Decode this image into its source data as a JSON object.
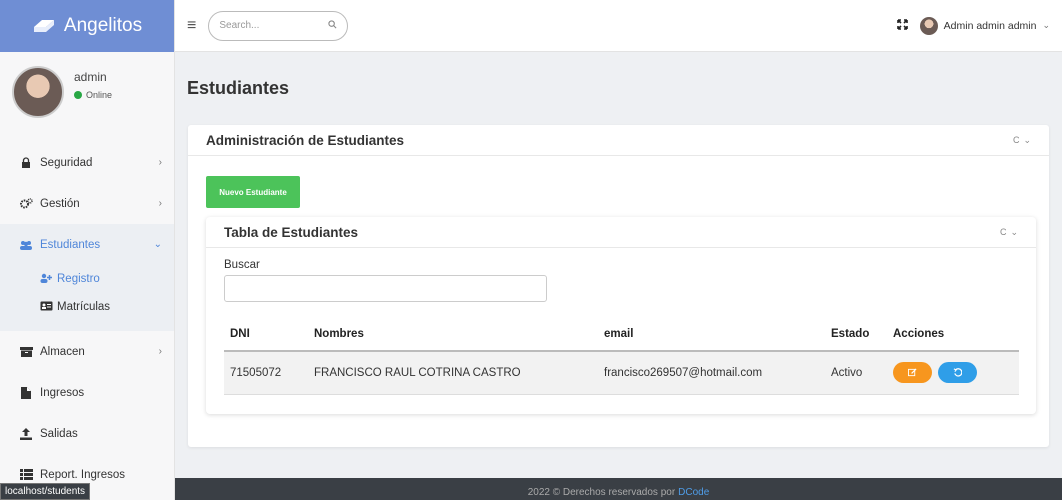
{
  "brand": {
    "name": "Angelitos"
  },
  "user_panel": {
    "name": "admin",
    "status": "Online"
  },
  "sidebar": {
    "items": [
      {
        "label": "Seguridad",
        "icon": "lock-icon",
        "arrow": "›"
      },
      {
        "label": "Gestión",
        "icon": "cogs-icon",
        "arrow": "›"
      },
      {
        "label": "Estudiantes",
        "icon": "users-icon",
        "arrow": "⌄"
      },
      {
        "label": "Almacen",
        "icon": "archive-icon",
        "arrow": "›"
      },
      {
        "label": "Ingresos",
        "icon": "file-icon",
        "arrow": ""
      },
      {
        "label": "Salidas",
        "icon": "upload-icon",
        "arrow": ""
      },
      {
        "label": "Report. Ingresos",
        "icon": "list-icon",
        "arrow": ""
      }
    ],
    "subitems": [
      {
        "label": "Registro",
        "icon": "user-plus-icon"
      },
      {
        "label": "Matrículas",
        "icon": "id-card-icon"
      }
    ]
  },
  "topbar": {
    "search_placeholder": "Search...",
    "user_label": "Admin admin admin"
  },
  "page": {
    "title": "Estudiantes"
  },
  "card": {
    "title": "Administración de Estudiantes",
    "new_button": "Nuevo Estudiante"
  },
  "table_card": {
    "title": "Tabla de Estudiantes",
    "search_label": "Buscar",
    "columns": [
      "DNI",
      "Nombres",
      "email",
      "Estado",
      "Acciones"
    ],
    "rows": [
      {
        "dni": "71505072",
        "nombres": "FRANCISCO RAUL COTRINA CASTRO",
        "email": "francisco269507@hotmail.com",
        "estado": "Activo"
      }
    ]
  },
  "footer": {
    "text": "2022 © Derechos reservados por",
    "link": "DCode"
  },
  "status_url": "localhost/students",
  "colors": {
    "brand": "#6f8ed4",
    "accent": "#4f86d9",
    "success": "#4cc35a",
    "warning": "#f7961e",
    "info": "#2f9ee8"
  }
}
